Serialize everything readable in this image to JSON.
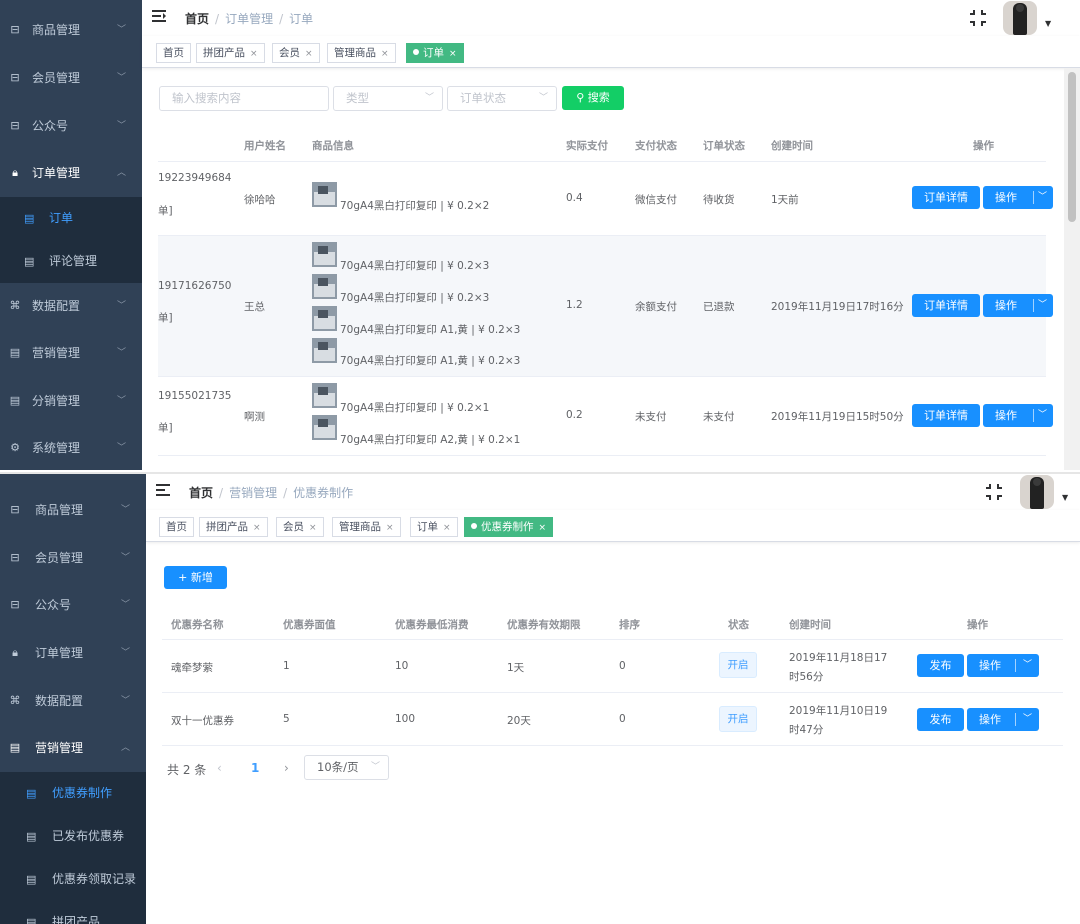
{
  "colors": {
    "sidebar_bg": "#304156",
    "submenu_bg": "#1f2d3d",
    "active_link": "#409eff",
    "primary": "#1890ff",
    "success": "#13ce66",
    "tag_active": "#42b983"
  },
  "screen1": {
    "sidebar": {
      "items": [
        {
          "icon": "box-icon",
          "label": "商品管理"
        },
        {
          "icon": "box-icon",
          "label": "会员管理"
        },
        {
          "icon": "box-icon",
          "label": "公众号"
        },
        {
          "icon": "lock-icon",
          "label": "订单管理",
          "open": true
        },
        {
          "icon": "doc-icon",
          "label": "订单",
          "sub": true,
          "active": true
        },
        {
          "icon": "doc-icon",
          "label": "评论管理",
          "sub": true
        },
        {
          "icon": "grid-icon",
          "label": "数据配置"
        },
        {
          "icon": "doc-icon",
          "label": "营销管理"
        },
        {
          "icon": "doc-icon",
          "label": "分销管理"
        },
        {
          "icon": "gear-icon",
          "label": "系统管理"
        }
      ]
    },
    "breadcrumb": [
      "首页",
      "订单管理",
      "订单"
    ],
    "tags": [
      "首页",
      "拼团产品",
      "会员",
      "管理商品",
      "订单"
    ],
    "filters": {
      "search_placeholder": "输入搜索内容",
      "type_placeholder": "类型",
      "status_placeholder": "订单状态",
      "search_button": "搜索"
    },
    "table": {
      "headers": [
        "用户姓名",
        "商品信息",
        "实际支付",
        "支付状态",
        "订单状态",
        "创建时间",
        "操作"
      ],
      "detail_button": "订单详情",
      "action_button": "操作",
      "rows": [
        {
          "order_no": "19223949684",
          "order_suffix": "单]",
          "user": "徐哈哈",
          "items": [
            "70gA4黑白打印复印 | ¥ 0.2×2"
          ],
          "paid": "0.4",
          "pay_status": "微信支付",
          "order_status": "待收货",
          "created": "1天前"
        },
        {
          "order_no": "19171626750",
          "order_suffix": "单]",
          "user": "王总",
          "items": [
            "70gA4黑白打印复印 | ¥ 0.2×3",
            "70gA4黑白打印复印 | ¥ 0.2×3",
            "70gA4黑白打印复印 A1,黄 | ¥ 0.2×3",
            "70gA4黑白打印复印 A1,黄 | ¥ 0.2×3"
          ],
          "paid": "1.2",
          "pay_status": "余额支付",
          "order_status": "已退款",
          "created": "2019年11月19日17时16分"
        },
        {
          "order_no": "19155021735",
          "order_suffix": "单]",
          "user": "啊测",
          "items": [
            "70gA4黑白打印复印 | ¥ 0.2×1",
            "70gA4黑白打印复印 A2,黄 | ¥ 0.2×1"
          ],
          "paid": "0.2",
          "pay_status": "未支付",
          "order_status": "未支付",
          "created": "2019年11月19日15时50分"
        }
      ]
    }
  },
  "screen2": {
    "sidebar": {
      "items": [
        {
          "icon": "box-icon",
          "label": "商品管理"
        },
        {
          "icon": "box-icon",
          "label": "会员管理"
        },
        {
          "icon": "box-icon",
          "label": "公众号"
        },
        {
          "icon": "lock-icon",
          "label": "订单管理"
        },
        {
          "icon": "grid-icon",
          "label": "数据配置"
        },
        {
          "icon": "doc-icon",
          "label": "营销管理",
          "open": true
        },
        {
          "icon": "doc-icon",
          "label": "优惠券制作",
          "sub": true,
          "active": true
        },
        {
          "icon": "doc-icon",
          "label": "已发布优惠券",
          "sub": true
        },
        {
          "icon": "doc-icon",
          "label": "优惠券领取记录",
          "sub": true
        },
        {
          "icon": "doc-icon",
          "label": "拼团产品",
          "sub": true
        }
      ]
    },
    "breadcrumb": [
      "首页",
      "营销管理",
      "优惠券制作"
    ],
    "tags": [
      "首页",
      "拼团产品",
      "会员",
      "管理商品",
      "订单",
      "优惠券制作"
    ],
    "add_button": "+ 新增",
    "table": {
      "headers": [
        "优惠券名称",
        "优惠券面值",
        "优惠券最低消费",
        "优惠券有效期限",
        "排序",
        "状态",
        "创建时间",
        "操作"
      ],
      "publish_button": "发布",
      "action_button": "操作",
      "rows": [
        {
          "name": "魂牵梦萦",
          "value": "1",
          "min_spend": "10",
          "validity": "1天",
          "sort": "0",
          "status": "开启",
          "created_line1": "2019年11月18日17",
          "created_line2": "时56分"
        },
        {
          "name": "双十一优惠券",
          "value": "5",
          "min_spend": "100",
          "validity": "20天",
          "sort": "0",
          "status": "开启",
          "created_line1": "2019年11月10日19",
          "created_line2": "时47分"
        }
      ]
    },
    "pagination": {
      "total": "共 2 条",
      "current_page": "1",
      "page_size": "10条/页"
    }
  }
}
